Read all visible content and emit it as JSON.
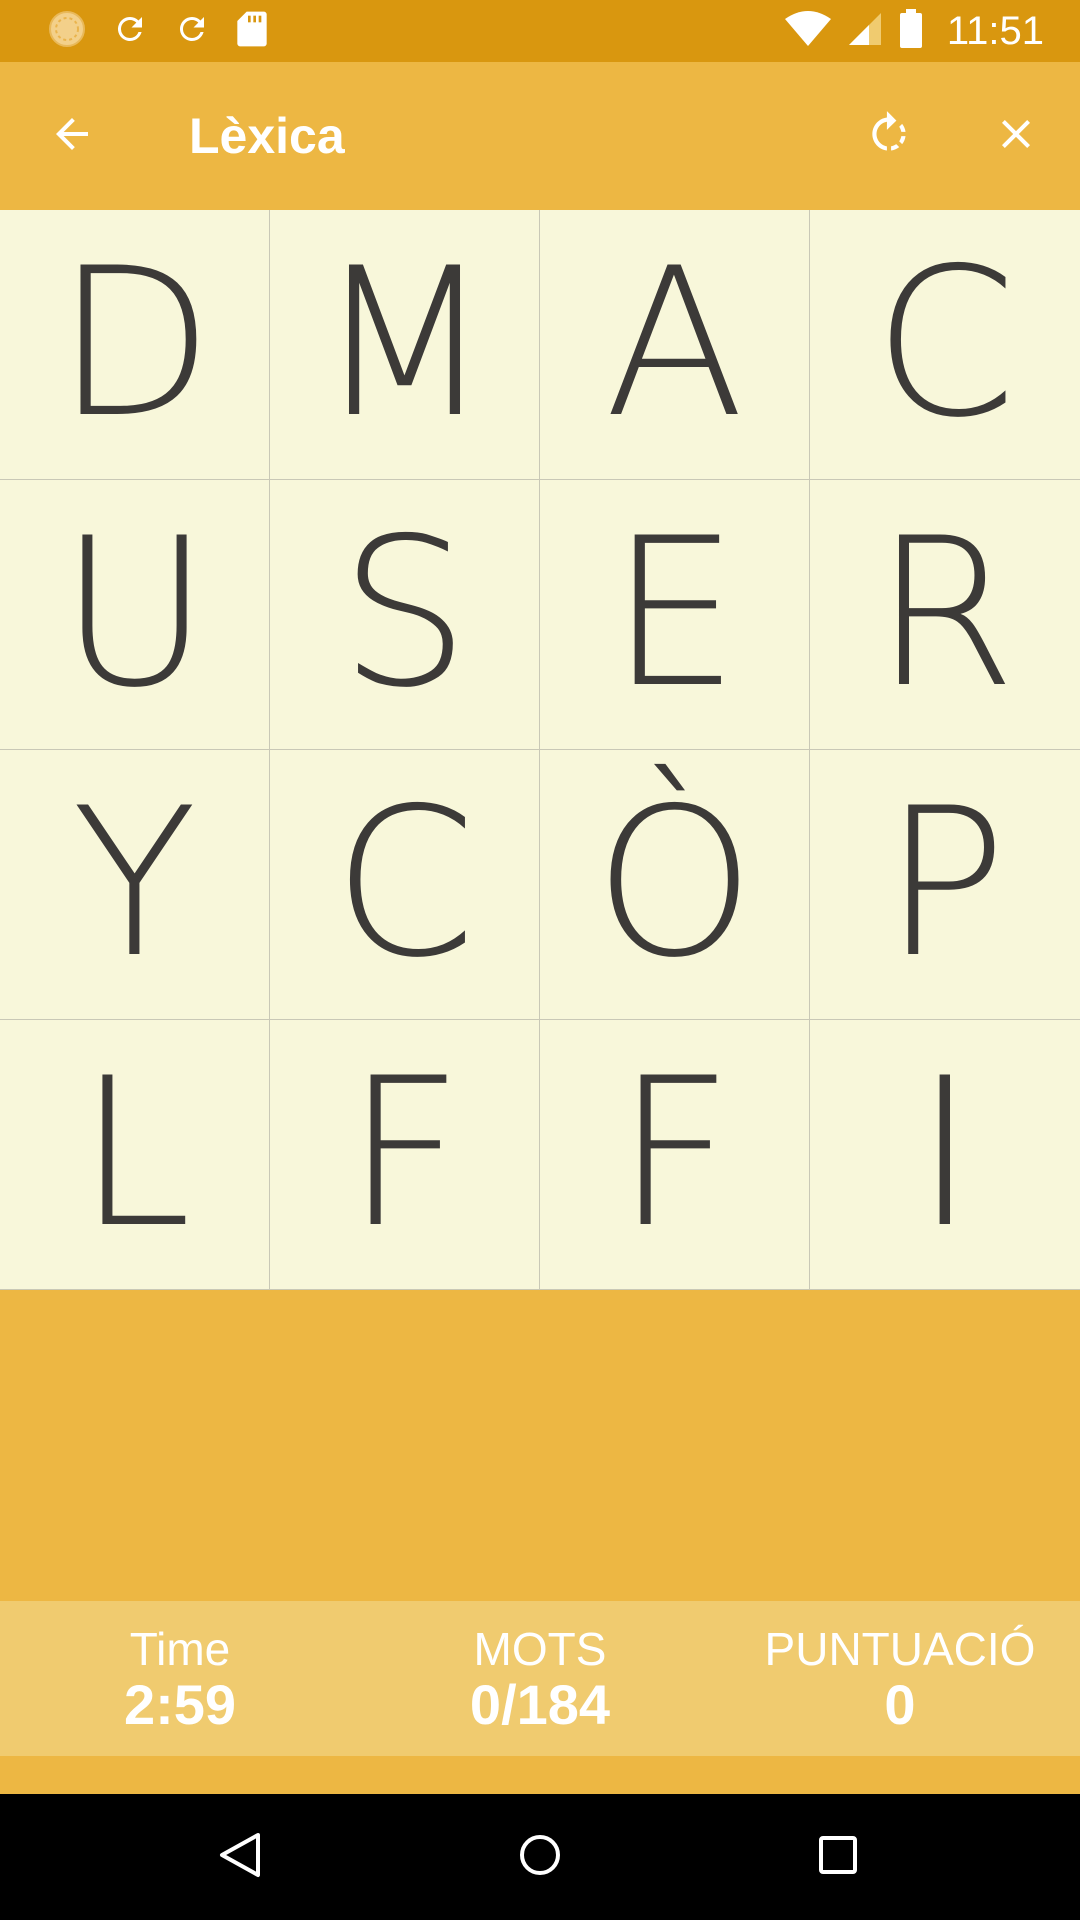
{
  "status_bar": {
    "time": "11:51",
    "icons": [
      "circle-sun-icon",
      "refresh-icon",
      "refresh-icon",
      "sd-card-icon",
      "wifi-icon",
      "signal-icon",
      "battery-icon"
    ]
  },
  "app_bar": {
    "title": "Lèxica",
    "icons": [
      "back-arrow-icon",
      "rotate-icon",
      "close-icon"
    ]
  },
  "board": {
    "letters": [
      "D",
      "M",
      "A",
      "C",
      "U",
      "S",
      "E",
      "R",
      "Y",
      "C",
      "Ò",
      "P",
      "L",
      "F",
      "F",
      "I"
    ]
  },
  "stats": {
    "time_label": "Time",
    "time_value": "2:59",
    "words_label": "MOTS",
    "words_value": "0/184",
    "score_label": "PUNTUACIÓ",
    "score_value": "0"
  },
  "colors": {
    "status_bar": "#d9970f",
    "app_bar": "#edb743",
    "board_bg": "#f8f7da",
    "score_bar": "#f0cb6f",
    "letter": "#3c3a38"
  },
  "nav_bar": {
    "icons": [
      "back-triangle-icon",
      "home-circle-icon",
      "recents-square-icon"
    ]
  }
}
